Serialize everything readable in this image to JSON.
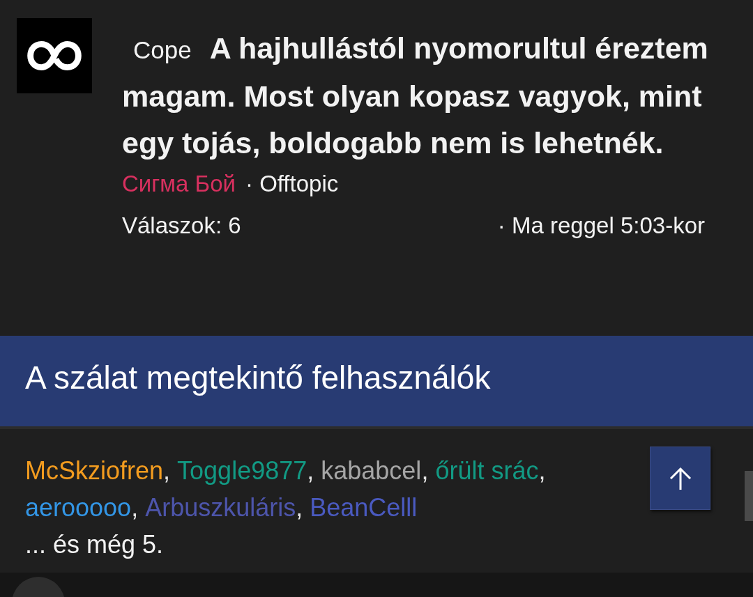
{
  "thread": {
    "prefix": "Cope",
    "title": "A hajhullástól nyomorultul éreztem magam. Most olyan kopasz vagyok, mint egy tojás, boldogabb nem is lehetnék.",
    "author": "Сигма Бой",
    "forum": "· Offtopic",
    "replies": "Válaszok: 6",
    "time": "· Ma reggel 5:03-kor"
  },
  "viewers": {
    "heading": "A szálat megtekintő felhasználók",
    "separator": ",",
    "users": [
      {
        "name": "McSkziofren",
        "color": "#f39c1f"
      },
      {
        "name": "Toggle9877",
        "color": "#129a84"
      },
      {
        "name": "kababcel",
        "color": "#a6a6a6"
      },
      {
        "name": "őrült srác",
        "color": "#129a84"
      },
      {
        "name": "aerooooo",
        "color": "#3396e6"
      },
      {
        "name": "Arbuszkuláris",
        "color": "#4d55ab"
      },
      {
        "name": "BeanCelll",
        "color": "#4a5ac0"
      }
    ],
    "more": "... és még 5."
  }
}
